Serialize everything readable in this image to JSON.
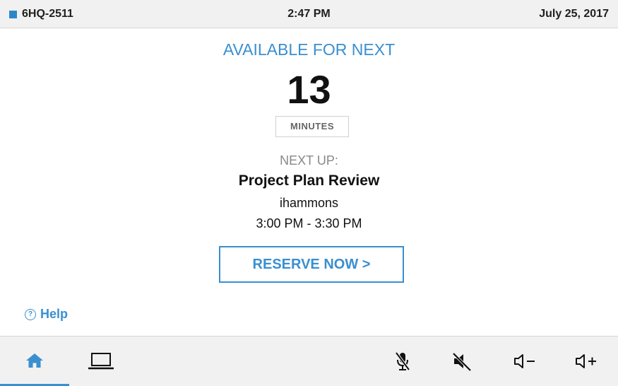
{
  "status_bar": {
    "room_name": "6HQ-2511",
    "time": "2:47 PM",
    "date": "July 25, 2017"
  },
  "availability": {
    "heading": "AVAILABLE FOR NEXT",
    "minutes": "13",
    "unit": "MINUTES"
  },
  "next_meeting": {
    "label": "NEXT UP:",
    "title": "Project Plan Review",
    "organizer": "ihammons",
    "time_range": "3:00 PM - 3:30 PM"
  },
  "actions": {
    "reserve_label": "RESERVE NOW >",
    "help_label": "Help",
    "help_icon_glyph": "?"
  },
  "bottom_nav": {
    "active_tab": "home",
    "icons": [
      "home-icon",
      "laptop-icon",
      "microphone-muted-icon",
      "speaker-muted-icon",
      "volume-down-icon",
      "volume-up-icon"
    ]
  },
  "colors": {
    "accent": "#3a8fd0",
    "bar_background": "#f1f1f1"
  }
}
